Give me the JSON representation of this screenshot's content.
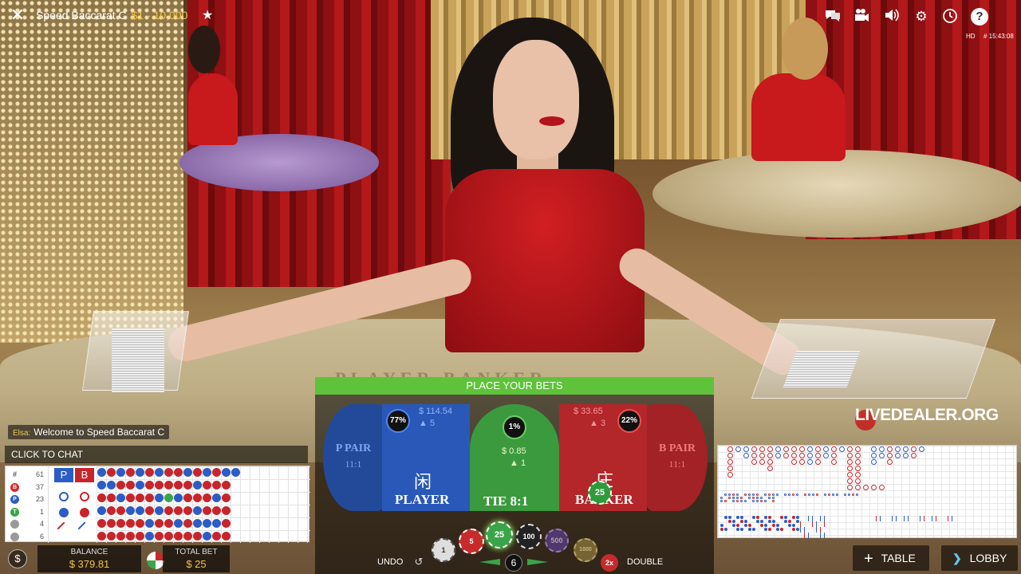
{
  "header": {
    "title": "Speed Baccarat C",
    "limits": "$1 - 10,000",
    "quality": "HD",
    "game_id": "# 15:43:08"
  },
  "icons": {
    "close": "close-icon",
    "favorite": "star-icon",
    "chat": "chat-icon",
    "video": "video-camera-icon",
    "sound": "speaker-icon",
    "settings": "gear-icon",
    "history": "history-icon",
    "help": "help-icon"
  },
  "chat": {
    "user": "Elsa:",
    "message": "Welcome to Speed Baccarat C",
    "prompt": "CLICK TO CHAT"
  },
  "stats": [
    {
      "icon": "#",
      "value": "61",
      "color": "#ffffff"
    },
    {
      "icon": "B",
      "value": "37",
      "color": "#d12b2b"
    },
    {
      "icon": "P",
      "value": "23",
      "color": "#2c5cc5"
    },
    {
      "icon": "T",
      "value": "1",
      "color": "#3aa548"
    },
    {
      "icon": "",
      "value": "4",
      "color": "#9a9a9a"
    },
    {
      "icon": "",
      "value": "6",
      "color": "#9a9a9a"
    }
  ],
  "prediction": {
    "player_label": "P",
    "banker_label": "B"
  },
  "balance": {
    "label": "BALANCE",
    "value": "$ 379.81"
  },
  "total_bet": {
    "label": "TOTAL BET",
    "value": "$ 25"
  },
  "bet_panel": {
    "status": "PLACE YOUR BETS",
    "p_pair": {
      "name": "P PAIR",
      "odds": "11:1"
    },
    "b_pair": {
      "name": "B PAIR",
      "odds": "11:1"
    },
    "player": {
      "pct": "77%",
      "amount": "$ 114.54",
      "players": "5",
      "hanzi": "闲",
      "name": "PLAYER"
    },
    "tie": {
      "pct": "1%",
      "amount": "$ 0.85",
      "players": "1",
      "name": "TIE 8:1"
    },
    "banker": {
      "pct": "22%",
      "amount": "$ 33.65",
      "players": "3",
      "hanzi": "庄",
      "name": "BANKER",
      "chip": "25"
    },
    "undo": "UNDO",
    "double": "DOUBLE",
    "double_chip": "2x",
    "chip_count": "6",
    "chips": [
      "1",
      "5",
      "25",
      "100",
      "500",
      "1000"
    ]
  },
  "nav": {
    "table": "TABLE",
    "lobby": "LOBBY"
  },
  "watermark": "LIVEDEALER.ORG",
  "felt": "PLAYER            BANKER",
  "colors": {
    "player": "#2c5cc5",
    "banker": "#c6262b",
    "tie": "#3aa548",
    "accent": "#5ec33a",
    "gold": "#f3c34a"
  }
}
